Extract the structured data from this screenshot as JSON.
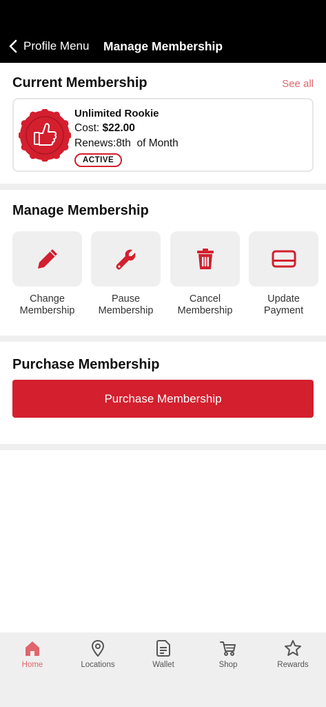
{
  "header": {
    "back_label": "Profile Menu",
    "title": "Manage Membership"
  },
  "current": {
    "section_title": "Current Membership",
    "see_all": "See all",
    "name": "Unlimited Rookie",
    "cost_label": "Cost:",
    "cost_value": "$22.00",
    "renews_label": "Renews:",
    "renews_value": "8th  of Month",
    "status": "ACTIVE"
  },
  "manage": {
    "section_title": "Manage Membership",
    "actions": [
      {
        "line1": "Change",
        "line2": "Membership",
        "icon": "pencil-icon"
      },
      {
        "line1": "Pause",
        "line2": "Membership",
        "icon": "wrench-icon"
      },
      {
        "line1": "Cancel",
        "line2": "Membership",
        "icon": "trash-icon"
      },
      {
        "line1": "Update",
        "line2": "Payment",
        "icon": "card-icon"
      }
    ]
  },
  "purchase": {
    "section_title": "Purchase Membership",
    "button_label": "Purchase Membership"
  },
  "tabs": [
    {
      "label": "Home",
      "icon": "home-icon",
      "active": true
    },
    {
      "label": "Locations",
      "icon": "location-pin-icon",
      "active": false
    },
    {
      "label": "Wallet",
      "icon": "document-icon",
      "active": false
    },
    {
      "label": "Shop",
      "icon": "cart-icon",
      "active": false
    },
    {
      "label": "Rewards",
      "icon": "star-icon",
      "active": false
    }
  ],
  "colors": {
    "brand_red": "#d31f2e",
    "accent_pink": "#e0656c",
    "header_bg": "#000000",
    "tile_bg": "#efefef"
  }
}
